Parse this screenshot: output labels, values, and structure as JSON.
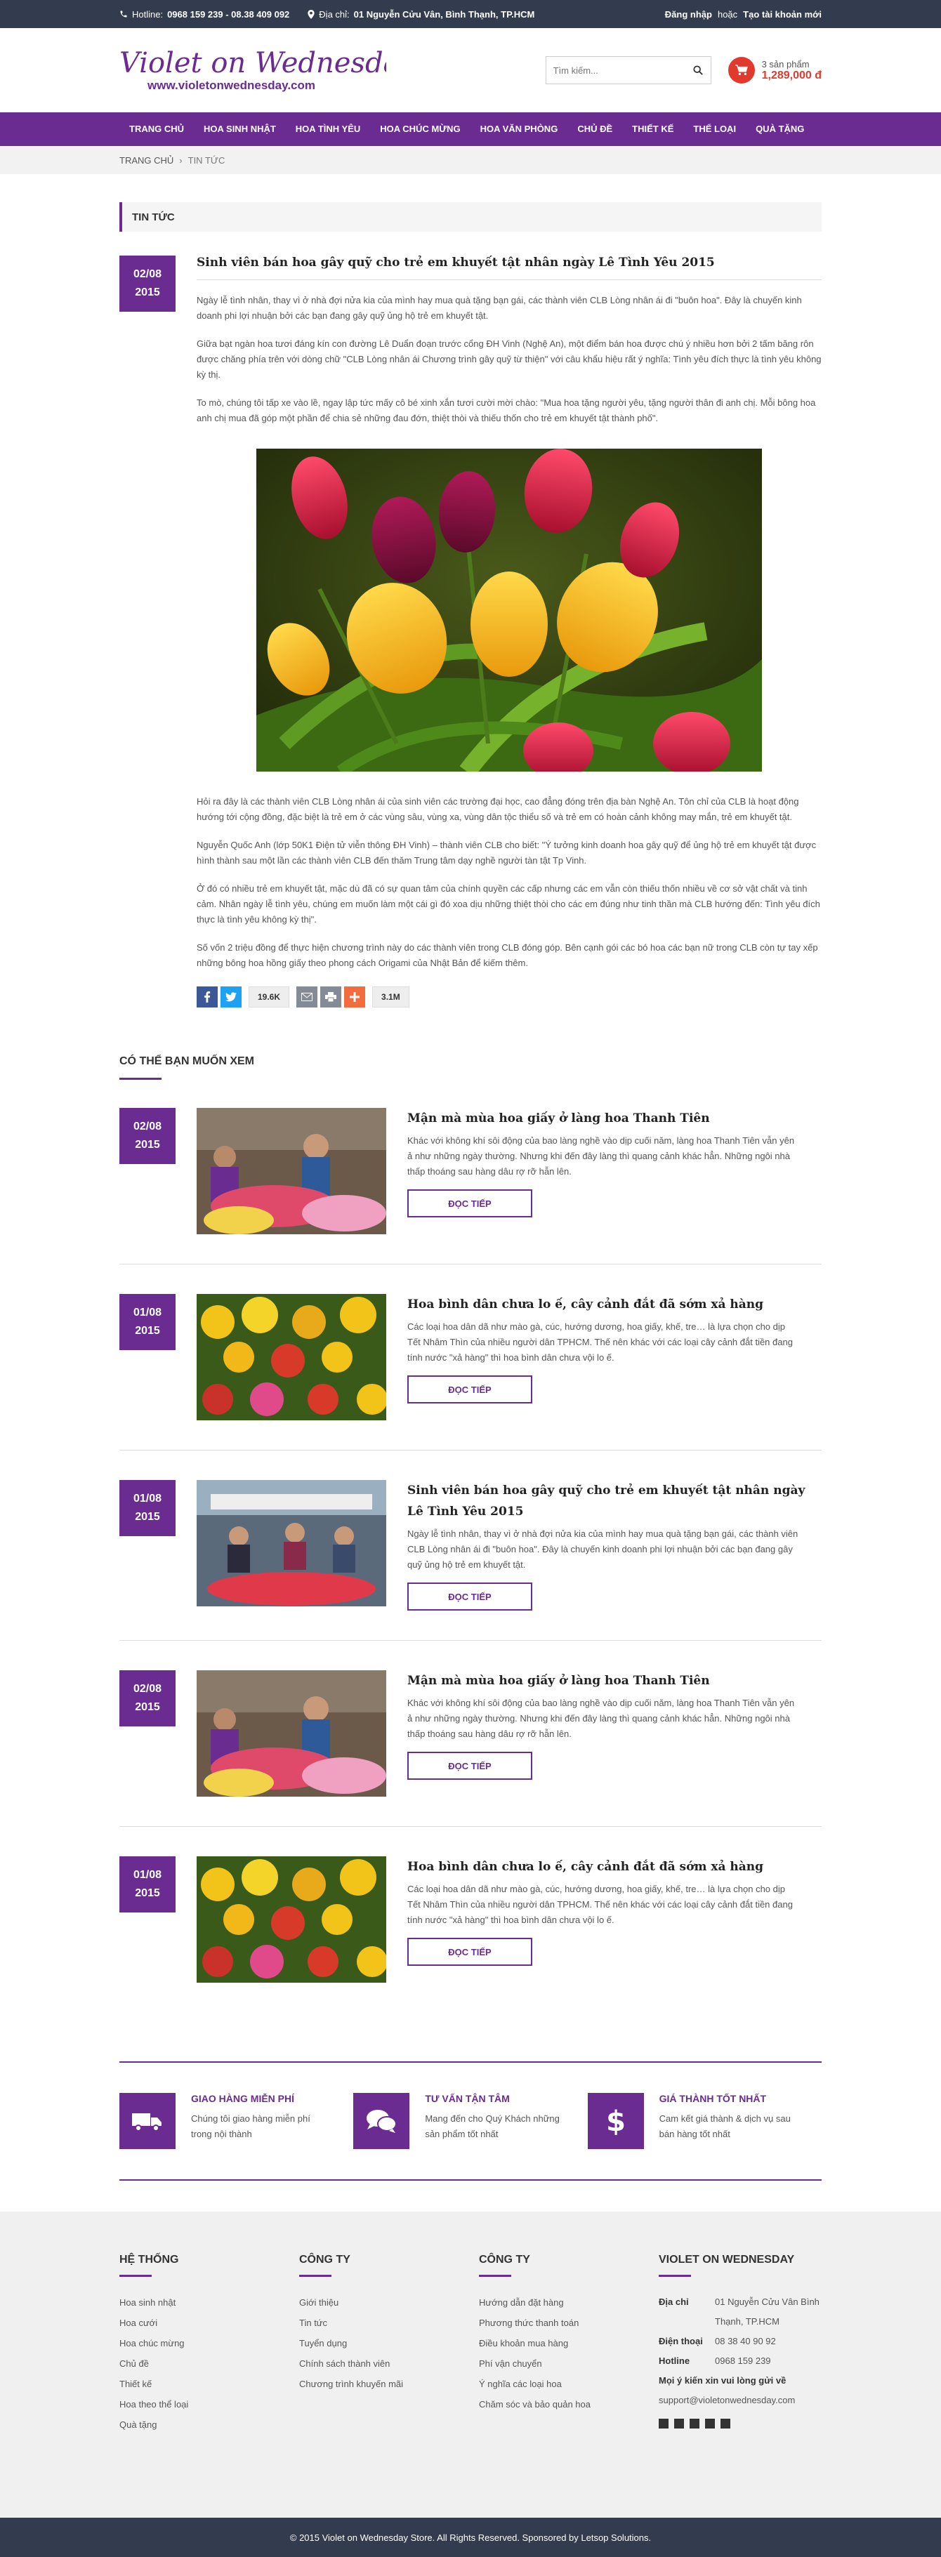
{
  "topbar": {
    "hotline_label": "Hotline:",
    "hotline_value": "0968 159 239 - 08.38 409 092",
    "address_label": "Địa chỉ:",
    "address_value": "01 Nguyễn Cửu Vân, Bình Thạnh, TP.HCM",
    "login": "Đăng nhập",
    "or": "hoặc",
    "register": "Tạo tài khoản mới"
  },
  "header": {
    "logo_text": "Violet on Wednesday",
    "logo_url": "www.violetonwednesday.com",
    "search_placeholder": "Tìm kiếm...",
    "cart_count": "3 sản phẩm",
    "cart_total": "1,289,000 đ",
    "accent": "#6a2c91",
    "cart_color": "#e13a2d"
  },
  "nav": [
    "TRANG CHỦ",
    "HOA SINH NHẬT",
    "HOA TÌNH YÊU",
    "HOA CHÚC MỪNG",
    "HOA VĂN PHÒNG",
    "CHỦ ĐỀ",
    "THIẾT KẾ",
    "THỂ LOẠI",
    "QUÀ TẶNG"
  ],
  "breadcrumb": {
    "home": "TRANG CHỦ",
    "sep": "›",
    "current": "TIN TỨC"
  },
  "section_title": "TIN TỨC",
  "article": {
    "date_day": "02/08",
    "date_year": "2015",
    "title": "Sinh viên bán hoa gây quỹ cho trẻ em khuyết tật nhân ngày Lê Tình Yêu 2015",
    "paragraphs_top": [
      "Ngày lễ tình nhân, thay vì ở nhà đợi nửa kia của mình hay mua quà tặng bạn gái, các thành viên CLB Lòng nhân ái đi \"buôn hoa\". Đây là chuyến kinh doanh phi lợi nhuận bởi các bạn đang gây quỹ ủng hộ trẻ em khuyết tật.",
      "Giữa bạt ngàn hoa tươi đáng kín con đường Lê Duẩn đoạn trước cổng ĐH Vinh (Nghệ An), một điểm bán hoa được chú ý nhiều hơn bởi 2 tấm băng rôn được chăng phía trên với dòng chữ \"CLB Lòng nhân ái Chương trình gây quỹ từ thiện\" với câu khẩu hiệu rất ý nghĩa: Tình yêu đích thực là tình yêu không kỳ thị.",
      "To mò, chúng tôi tấp xe vào lề, ngay lập tức mấy cô bé xinh xắn tươi cười mời chào: \"Mua hoa tặng người yêu, tặng người thân đi anh chị. Mỗi bông hoa anh chị mua đã góp một phần để chia sẻ những đau đớn, thiệt thòi và thiếu thốn cho trẻ em khuyết tật thành phố\"."
    ],
    "paragraphs_bottom": [
      "Hỏi ra đây là các thành viên CLB Lòng nhân ái của sinh viên các trường đại học, cao đẳng đóng trên địa bàn Nghệ An. Tôn chỉ của CLB là hoạt động hướng tới cộng đồng, đặc biệt là trẻ em ở các vùng sâu, vùng xa, vùng dân tộc thiểu số và trẻ em có hoàn cảnh không may mắn, trẻ em khuyết tật.",
      "Nguyễn Quốc Anh (lớp 50K1 Điện tử viễn thông ĐH Vinh) – thành viên CLB cho biết: \"Ý tưởng kinh doanh hoa gây quỹ để ủng hộ trẻ em khuyết tật được hình thành sau một lần các thành viên CLB đến thăm Trung tâm dạy nghề người tàn tật Tp Vinh.",
      "Ở đó có nhiều trẻ em khuyết tật, mặc dù đã có sự quan tâm của chính quyền các cấp nhưng các em vẫn còn thiếu thốn nhiều về cơ sở vật chất và tinh cảm. Nhân ngày lễ tình yêu, chúng em muốn làm một cái gì đó xoa dịu những thiệt thòi cho các em đúng như tinh thần mà CLB hướng đến: Tình yêu đích thực là tình yêu không kỳ thị\".",
      "Số vốn 2 triệu đồng để thực hiện chương trình này do các thành viên trong CLB đóng góp. Bên cạnh gói các bó hoa các bạn nữ trong CLB còn tự tay xếp những bông hoa hồng giấy theo phong cách Origami của Nhật Bản để kiếm thêm."
    ],
    "share_count_1": "19.6K",
    "share_count_2": "3.1M"
  },
  "related": {
    "heading": "CÓ THỂ BẠN MUỐN XEM",
    "read_more": "ĐỌC TIẾP",
    "items": [
      {
        "day": "02/08",
        "year": "2015",
        "title": "Mận mà mùa hoa giấy ở làng hoa Thanh Tiên",
        "desc": "Khác với không khí sôi động của bao làng nghề vào dịp cuối năm, làng hoa Thanh Tiên vẫn yên ả như những ngày thường. Nhưng khi đến đây làng thì quang cảnh khác hẳn. Những ngôi nhà thấp thoáng sau hàng dâu rợ rỡ hẫn lên."
      },
      {
        "day": "01/08",
        "year": "2015",
        "title": "Hoa bình dân chưa lo ế, cây cảnh đắt đã sớm xả hàng",
        "desc": "Các loại hoa dân dã như mào gà, cúc, hướng dương, hoa giấy, khế, tre… là lựa chọn cho dịp Tết Nhâm Thìn của nhiều người dân TPHCM. Thế nên khác với các loại cây cảnh đắt tiền đang tính nước \"xả hàng\" thì hoa bình dân chưa vội lo ế."
      },
      {
        "day": "01/08",
        "year": "2015",
        "title": "Sinh viên bán hoa gây quỹ cho trẻ em khuyết tật nhân ngày Lê Tình Yêu 2015",
        "desc": "Ngày lễ tình nhân, thay vì ở nhà đợi nửa kia của mình hay mua quà tặng bạn gái, các thành viên CLB Lòng nhân ái đi \"buôn hoa\". Đây là chuyến kinh doanh phi lợi nhuận bởi các bạn đang gây quỹ ủng hộ trẻ em khuyết tật."
      },
      {
        "day": "02/08",
        "year": "2015",
        "title": "Mận mà mùa hoa giấy ở làng hoa Thanh Tiên",
        "desc": "Khác với không khí sôi động của bao làng nghề vào dịp cuối năm, làng hoa Thanh Tiên vẫn yên ả như những ngày thường. Nhưng khi đến đây làng thì quang cảnh khác hẳn. Những ngôi nhà thấp thoáng sau hàng dâu rợ rỡ hẫn lên."
      },
      {
        "day": "01/08",
        "year": "2015",
        "title": "Hoa bình dân chưa lo ế, cây cảnh đắt đã sớm xả hàng",
        "desc": "Các loại hoa dân dã như mào gà, cúc, hướng dương, hoa giấy, khế, tre… là lựa chọn cho dịp Tết Nhâm Thìn của nhiều người dân TPHCM. Thế nên khác với các loại cây cảnh đắt tiền đang tính nước \"xả hàng\" thì hoa bình dân chưa vội lo ế."
      }
    ]
  },
  "services": [
    {
      "icon": "truck-icon",
      "title": "GIAO HÀNG MIỄN PHÍ",
      "desc": "Chúng tôi giao hàng miễn phí trong nội thành"
    },
    {
      "icon": "chat-icon",
      "title": "TƯ VẤN TẬN TÂM",
      "desc": "Mang đến cho Quý Khách những sản phẩm tốt nhất"
    },
    {
      "icon": "dollar-icon",
      "title": "GIÁ THÀNH TỐT NHẤT",
      "desc": "Cam kết giá thành & dịch vụ sau bán hàng tốt nhất"
    }
  ],
  "footer": {
    "col1": {
      "title": "HỆ THỐNG",
      "items": [
        "Hoa sinh nhật",
        "Hoa cưới",
        "Hoa chúc mừng",
        "Chủ đề",
        "Thiết kế",
        "Hoa theo thể loại",
        "Quà tặng"
      ]
    },
    "col2": {
      "title": "CÔNG TY",
      "items": [
        "Giới thiệu",
        "Tin tức",
        "Tuyển dụng",
        "Chính sách thành viên",
        "Chương trình khuyến mãi"
      ]
    },
    "col3": {
      "title": "CÔNG TY",
      "items": [
        "Hướng dẫn đặt hàng",
        "Phương thức thanh toán",
        "Điều khoản mua hàng",
        "Phí vận chuyển",
        "Ý nghĩa các loại hoa",
        "Chăm sóc và bảo quản hoa"
      ]
    },
    "col4": {
      "title": "VIOLET ON WEDNESDAY",
      "address_label": "Địa chỉ",
      "address": "01 Nguyễn Cửu Vân Bình Thạnh, TP.HCM",
      "phone_label": "Điện thoại",
      "phone": "08 38 40 90 92",
      "hotline_label": "Hotline",
      "hotline": "0968 159 239",
      "feedback": "Mọi ý kiến xin vui lòng gửi về",
      "email": "support@violetonwednesday.com"
    },
    "copyright": "© 2015 Violet on Wednesday Store. All Rights Reserved. Sponsored by Letsop Solutions."
  }
}
